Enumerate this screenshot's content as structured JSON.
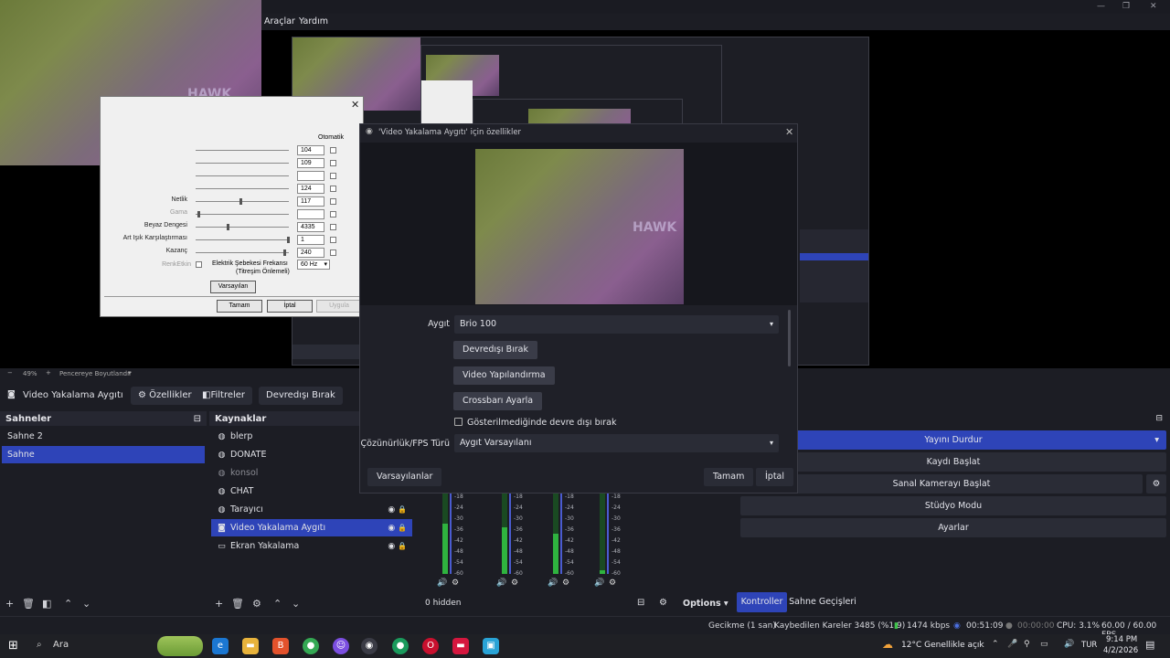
{
  "menu": {
    "items": [
      "Araçlar",
      "Yardım"
    ]
  },
  "window_controls": {
    "minimize": "—",
    "restore": "❐",
    "close": "✕"
  },
  "zoom": {
    "level": "49%",
    "mode": "Pencereye Boyutlandır"
  },
  "source_bar": {
    "selected_source": "Video Yakalama Aygıtı",
    "properties": "Özellikler",
    "filters": "Filtreler",
    "deactivate": "Devredışı Bırak"
  },
  "scenes": {
    "title": "Sahneler",
    "items": [
      {
        "label": "Sahne 2",
        "selected": false
      },
      {
        "label": "Sahne",
        "selected": true
      }
    ]
  },
  "sources": {
    "title": "Kaynaklar",
    "items": [
      {
        "label": "blerp",
        "icon": "globe-icon",
        "visible_controls": false,
        "dim": false,
        "selected": false
      },
      {
        "label": "DONATE",
        "icon": "globe-icon",
        "visible_controls": false,
        "dim": false,
        "selected": false
      },
      {
        "label": "konsol",
        "icon": "globe-icon",
        "visible_controls": false,
        "dim": true,
        "selected": false
      },
      {
        "label": "CHAT",
        "icon": "globe-icon",
        "visible_controls": false,
        "dim": false,
        "selected": false
      },
      {
        "label": "Tarayıcı",
        "icon": "globe-icon",
        "visible_controls": true,
        "dim": false,
        "selected": false
      },
      {
        "label": "Video Yakalama Aygıtı",
        "icon": "camera-icon",
        "visible_controls": true,
        "dim": false,
        "selected": true
      },
      {
        "label": "Ekran Yakalama",
        "icon": "monitor-icon",
        "visible_controls": true,
        "dim": false,
        "selected": false
      }
    ]
  },
  "mixer": {
    "hidden_count": "0 hidden",
    "options": "Options",
    "scale": [
      "-18",
      "-24",
      "-30",
      "-36",
      "-42",
      "-48",
      "-54",
      "-60"
    ]
  },
  "controls": {
    "stop_stream": "Yayını Durdur",
    "start_recording": "Kaydı Başlat",
    "start_virtual_cam": "Sanal Kamerayı Başlat",
    "studio_mode": "Stüdyo Modu",
    "settings": "Ayarlar",
    "tab_controls": "Kontroller",
    "tab_transitions": "Sahne Geçişleri"
  },
  "properties_dialog": {
    "title": "'Video Yakalama Aygıtı' için özellikler",
    "device_label": "Aygıt",
    "device_value": "Brio 100",
    "btn_deactivate": "Devredışı Bırak",
    "btn_video_config": "Video Yapılandırma",
    "btn_crossbar": "Crossbarı Ayarla",
    "checkbox_hidden_deactivate": "Gösterilmediğinde devre dışı bırak",
    "res_label": "Çözünürlük/FPS Türü",
    "res_value": "Aygıt Varsayılanı",
    "btn_defaults": "Varsayılanlar",
    "btn_ok": "Tamam",
    "btn_cancel": "İptal"
  },
  "legacy_dialog": {
    "auto_header": "Otomatik",
    "rows": [
      {
        "label": "",
        "value": "104",
        "dim": false
      },
      {
        "label": "",
        "value": "109",
        "dim": false
      },
      {
        "label": "",
        "value": "",
        "dim": false
      },
      {
        "label": "",
        "value": "124",
        "dim": false
      },
      {
        "label": "Netlik",
        "value": "117",
        "dim": false
      },
      {
        "label": "Gama",
        "value": "",
        "dim": true
      },
      {
        "label": "Beyaz Dengesi",
        "value": "4335",
        "dim": false
      },
      {
        "label": "Art Işık Karşılaştırması",
        "value": "1",
        "dim": false
      },
      {
        "label": "Kazanç",
        "value": "240",
        "dim": false
      }
    ],
    "color_enable": "RenkEtkin",
    "freq_label_1": "Elektrik Şebekesi Frekansı",
    "freq_label_2": "(Titreşim Önlemeli)",
    "freq_value": "60 Hz",
    "btn_defaults": "Varsayılan",
    "btn_ok": "Tamam",
    "btn_cancel": "İptal",
    "btn_apply": "Uygula"
  },
  "status": {
    "delay": "Gecikme (1 san)",
    "dropped": "Kaybedilen Kareler 3485 (%1.9)",
    "bitrate": "1474 kbps",
    "stream_time": "00:51:09",
    "rec_time": "00:00:00",
    "cpu": "CPU: 3.1%",
    "fps": "60.00 / 60.00 FPS"
  },
  "taskbar": {
    "search_placeholder": "Ara",
    "weather": "12°C  Genellikle açık",
    "lang": "TUR",
    "time": "9:14 PM",
    "date": "4/2/2026"
  },
  "colors": {
    "accent": "#2e44b8",
    "panel": "#1c1d24",
    "button": "#2a2c36"
  }
}
